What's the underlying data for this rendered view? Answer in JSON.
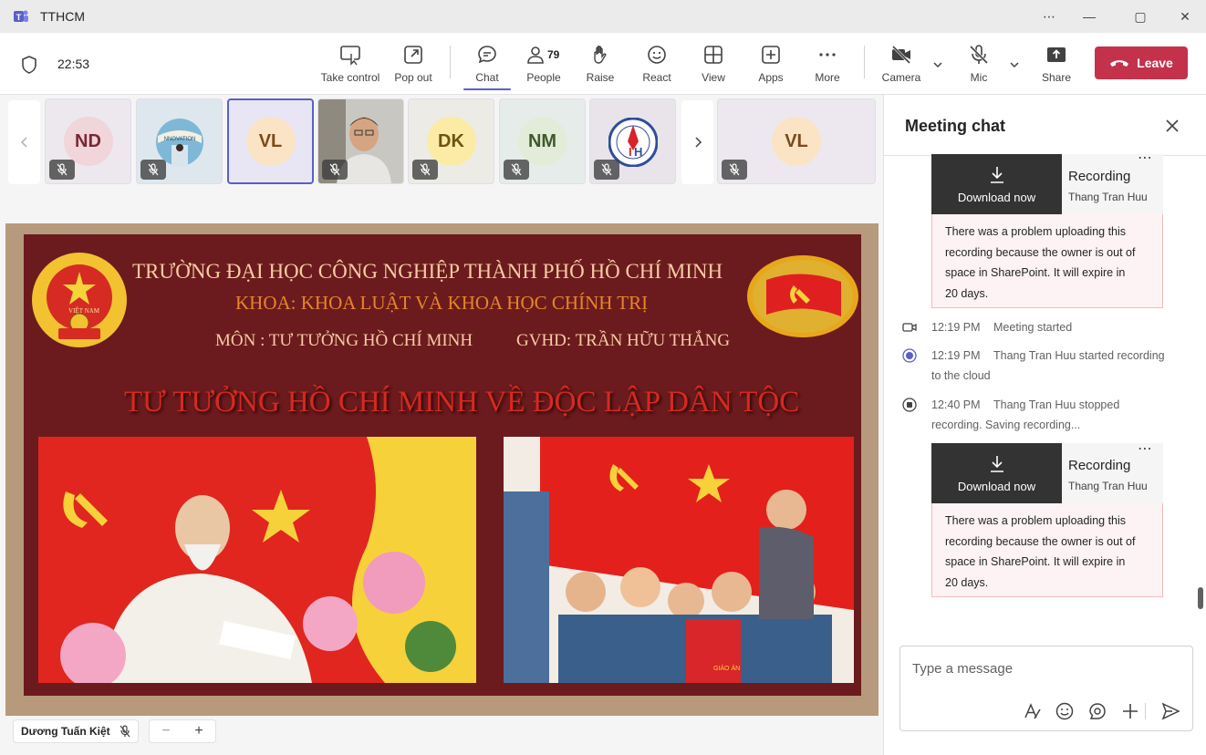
{
  "app": {
    "title": "TTHCM",
    "accent": "#5b5fc7",
    "leave_color": "#c4314b"
  },
  "window_controls": {
    "more": "⋯",
    "minimize": "—",
    "maximize": "▢",
    "close": "✕"
  },
  "toolbar": {
    "timer": "22:53",
    "buttons": [
      {
        "id": "take-control",
        "label": "Take control",
        "icon": "screen-pointer-icon"
      },
      {
        "id": "pop-out",
        "label": "Pop out",
        "icon": "pop-out-icon"
      },
      {
        "id": "chat",
        "label": "Chat",
        "icon": "chat-icon",
        "active": true
      },
      {
        "id": "people",
        "label": "People",
        "icon": "people-icon",
        "count": "79"
      },
      {
        "id": "raise",
        "label": "Raise",
        "icon": "hand-icon"
      },
      {
        "id": "react",
        "label": "React",
        "icon": "smile-icon"
      },
      {
        "id": "view",
        "label": "View",
        "icon": "grid-icon"
      },
      {
        "id": "apps",
        "label": "Apps",
        "icon": "plus-square-icon"
      },
      {
        "id": "more",
        "label": "More",
        "icon": "ellipsis-icon"
      },
      {
        "id": "camera",
        "label": "Camera",
        "icon": "camera-off-icon"
      },
      {
        "id": "mic",
        "label": "Mic",
        "icon": "mic-off-icon"
      },
      {
        "id": "share",
        "label": "Share",
        "icon": "share-icon"
      }
    ],
    "leave_label": "Leave"
  },
  "participants": [
    {
      "initials": "ND",
      "avatar_bg": "#f0d5da",
      "avatar_fg": "#7a2732",
      "muted": true
    },
    {
      "initials": "",
      "kind": "image",
      "muted": true
    },
    {
      "initials": "VL",
      "avatar_bg": "#fbe3c6",
      "avatar_fg": "#7a4b1a",
      "muted": false,
      "selected": true
    },
    {
      "initials": "",
      "kind": "video",
      "muted": true
    },
    {
      "initials": "DK",
      "avatar_bg": "#fbeba6",
      "avatar_fg": "#6b5410",
      "muted": true
    },
    {
      "initials": "NM",
      "avatar_bg": "#e2ecd9",
      "avatar_fg": "#3f5a2a",
      "muted": true
    },
    {
      "initials": "",
      "kind": "logo",
      "muted": true
    },
    {
      "initials": "VL",
      "avatar_bg": "#fbe3c6",
      "avatar_fg": "#7a4b1a",
      "muted": true
    }
  ],
  "slide": {
    "line1": "TRƯỜNG ĐẠI HỌC CÔNG NGHIỆP THÀNH PHỐ HỒ CHÍ MINH",
    "line2": "KHOA: KHOA LUẬT VÀ KHOA HỌC CHÍNH TRỊ",
    "subject": "MÔN : TƯ TƯỞNG HỒ CHÍ MINH",
    "teacher": "GVHD: TRẦN HỮU THẮNG",
    "heading": "TƯ TƯỞNG HỒ CHÍ MINH VỀ ĐỘC LẬP DÂN TỘC",
    "emblem_text": "VIỆT NAM",
    "poster_sign": "GIÁO ÁN"
  },
  "presenter": {
    "name": "Dương Tuấn Kiệt"
  },
  "zoom": {
    "minus": "−",
    "plus": "+"
  },
  "chat": {
    "title": "Meeting chat",
    "recordings": [
      {
        "download_label": "Download now",
        "title": "Recording",
        "owner": "Thang Tran Huu",
        "more": "⋯",
        "warning_lines": [
          "There was a problem uploading this",
          "recording because the owner is out of",
          "space in SharePoint. It will expire in",
          "20 days."
        ]
      },
      {
        "download_label": "Download now",
        "title": "Recording",
        "owner": "Thang Tran Huu",
        "more": "⋯",
        "warning_lines": [
          "There was a problem uploading this",
          "recording because the owner is out of",
          "space in SharePoint. It will expire in",
          "20 days."
        ]
      }
    ],
    "events": [
      {
        "icon": "video-camera-icon",
        "time": "12:19 PM",
        "line1": "Meeting started",
        "line2": ""
      },
      {
        "icon": "record-icon",
        "time": "12:19 PM",
        "line1": "Thang Tran Huu started recording",
        "line2": "to the cloud"
      },
      {
        "icon": "stop-record-icon",
        "time": "12:40 PM",
        "line1": "Thang Tran Huu stopped",
        "line2": "recording. Saving recording..."
      }
    ],
    "compose_placeholder": "Type a message"
  }
}
